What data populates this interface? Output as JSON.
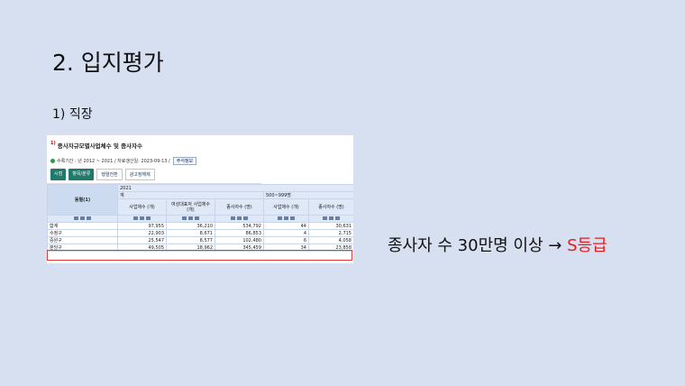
{
  "slide": {
    "title": "2. 입지평가",
    "subtitle": "1) 직장",
    "conclusion_text": "종사자 수 30만명 이상",
    "arrow": "→",
    "grade": "S등급",
    "grade_color": "#e31b1b"
  },
  "screenshot": {
    "panel_mark": "1)",
    "panel_title": "종사자규모별사업체수 및 종사자수",
    "meta_text": "수록기간 : 년 2012 ~ 2021 / 자료갱신일: 2023-09-13 /",
    "note_button": "주석정보",
    "buttons": {
      "time": "시점",
      "item": "항목/분류",
      "unit": "행렬전환",
      "ad": "광고정해제"
    },
    "header": {
      "row_label": "동별(1)",
      "year": "2021",
      "group1": "계",
      "group2": "500~999명",
      "cols": [
        "사업체수 (개)",
        "여성대표자 사업체수 (개)",
        "종사자수 (명)",
        "사업체수 (개)",
        "종사자수 (명)"
      ]
    },
    "rows": [
      {
        "name": "합계",
        "values": [
          "97,955",
          "36,210",
          "534,792",
          "44",
          "30,631"
        ]
      },
      {
        "name": "수정구",
        "values": [
          "22,903",
          "8,671",
          "86,853",
          "4",
          "2,715"
        ]
      },
      {
        "name": "중원구",
        "values": [
          "25,547",
          "8,577",
          "102,480",
          "6",
          "4,058"
        ]
      },
      {
        "name": "분당구",
        "values": [
          "49,505",
          "18,962",
          "345,459",
          "34",
          "23,858"
        ]
      }
    ]
  },
  "colors": {
    "background": "#d6e0f1",
    "highlight": "#e53935",
    "primary_button": "#1f7a6c"
  }
}
